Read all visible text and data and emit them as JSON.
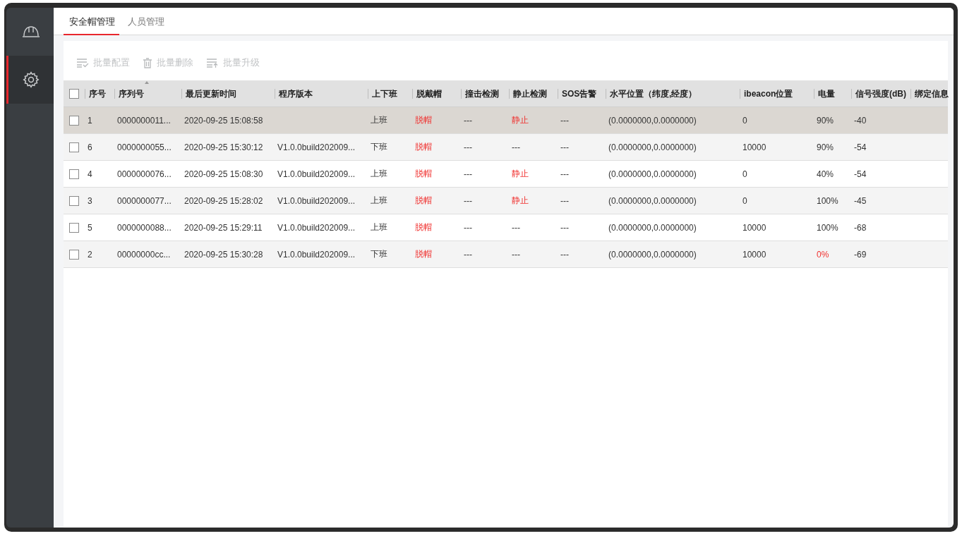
{
  "tabs": [
    {
      "label": "安全帽管理",
      "selected": true
    },
    {
      "label": "人员管理",
      "selected": false
    }
  ],
  "sidebar": {
    "items": [
      {
        "kind": "helmet",
        "selected": false
      },
      {
        "kind": "settings",
        "selected": true
      }
    ]
  },
  "toolbar": [
    {
      "kind": "config",
      "label": "批量配置",
      "disabled": true
    },
    {
      "kind": "delete",
      "label": "批量删除",
      "disabled": true
    },
    {
      "kind": "upgrade",
      "label": "批量升级",
      "disabled": true
    }
  ],
  "table": {
    "header_checked": false,
    "columns": [
      {
        "label": "序号",
        "sorted": false
      },
      {
        "label": "序列号",
        "sorted": true
      },
      {
        "label": "最后更新时间",
        "sorted": false
      },
      {
        "label": "程序版本",
        "sorted": false
      },
      {
        "label": "上下班",
        "sorted": false
      },
      {
        "label": "脱戴帽",
        "sorted": false
      },
      {
        "label": "撞击检测",
        "sorted": false
      },
      {
        "label": "静止检测",
        "sorted": false
      },
      {
        "label": "SOS告警",
        "sorted": false
      },
      {
        "label": "水平位置（纬度,经度）",
        "sorted": false
      },
      {
        "label": "ibeacon位置",
        "sorted": false
      },
      {
        "label": "电量",
        "sorted": false
      },
      {
        "label": "信号强度(dB)",
        "sorted": false
      },
      {
        "label": "绑定信息",
        "sorted": false
      }
    ],
    "rows": [
      {
        "selected": true,
        "checked": false,
        "cells": [
          {
            "text": "1"
          },
          {
            "text": "0000000011..."
          },
          {
            "text": "2020-09-25 15:08:58"
          },
          null,
          {
            "text": "上班"
          },
          {
            "text": "脱帽",
            "alert": true
          },
          {
            "text": "---"
          },
          {
            "text": "静止",
            "alert": true
          },
          {
            "text": "---"
          },
          {
            "text": "(0.0000000,0.0000000)"
          },
          {
            "text": "0"
          },
          {
            "text": "90%",
            "alert": false
          },
          {
            "text": "-40"
          }
        ]
      },
      {
        "selected": false,
        "checked": false,
        "cells": [
          {
            "text": "6"
          },
          {
            "text": "0000000055..."
          },
          {
            "text": "2020-09-25 15:30:12"
          },
          {
            "text": "V1.0.0build202009..."
          },
          {
            "text": "下班"
          },
          {
            "text": "脱帽",
            "alert": true
          },
          {
            "text": "---"
          },
          {
            "text": "---",
            "alert": false
          },
          {
            "text": "---"
          },
          {
            "text": "(0.0000000,0.0000000)"
          },
          {
            "text": "10000"
          },
          {
            "text": "90%",
            "alert": false
          },
          {
            "text": "-54"
          }
        ]
      },
      {
        "selected": false,
        "checked": false,
        "cells": [
          {
            "text": "4"
          },
          {
            "text": "0000000076..."
          },
          {
            "text": "2020-09-25 15:08:30"
          },
          {
            "text": "V1.0.0build202009..."
          },
          {
            "text": "上班"
          },
          {
            "text": "脱帽",
            "alert": true
          },
          {
            "text": "---"
          },
          {
            "text": "静止",
            "alert": true
          },
          {
            "text": "---"
          },
          {
            "text": "(0.0000000,0.0000000)"
          },
          {
            "text": "0"
          },
          {
            "text": "40%",
            "alert": false
          },
          {
            "text": "-54"
          }
        ]
      },
      {
        "selected": false,
        "checked": false,
        "cells": [
          {
            "text": "3"
          },
          {
            "text": "0000000077..."
          },
          {
            "text": "2020-09-25 15:28:02"
          },
          {
            "text": "V1.0.0build202009..."
          },
          {
            "text": "上班"
          },
          {
            "text": "脱帽",
            "alert": true
          },
          {
            "text": "---"
          },
          {
            "text": "静止",
            "alert": true
          },
          {
            "text": "---"
          },
          {
            "text": "(0.0000000,0.0000000)"
          },
          {
            "text": "0"
          },
          {
            "text": "100%",
            "alert": false
          },
          {
            "text": "-45"
          }
        ]
      },
      {
        "selected": false,
        "checked": false,
        "cells": [
          {
            "text": "5"
          },
          {
            "text": "0000000088..."
          },
          {
            "text": "2020-09-25 15:29:11"
          },
          {
            "text": "V1.0.0build202009..."
          },
          {
            "text": "上班"
          },
          {
            "text": "脱帽",
            "alert": true
          },
          {
            "text": "---"
          },
          {
            "text": "---",
            "alert": false
          },
          {
            "text": "---"
          },
          {
            "text": "(0.0000000,0.0000000)"
          },
          {
            "text": "10000"
          },
          {
            "text": "100%",
            "alert": false
          },
          {
            "text": "-68"
          }
        ]
      },
      {
        "selected": false,
        "checked": false,
        "cells": [
          {
            "text": "2"
          },
          {
            "text": "00000000cc..."
          },
          {
            "text": "2020-09-25 15:30:28"
          },
          {
            "text": "V1.0.0build202009..."
          },
          {
            "text": "下班"
          },
          {
            "text": "脱帽",
            "alert": true
          },
          {
            "text": "---"
          },
          {
            "text": "---",
            "alert": false
          },
          {
            "text": "---"
          },
          {
            "text": "(0.0000000,0.0000000)"
          },
          {
            "text": "10000"
          },
          {
            "text": "0%",
            "alert": true
          },
          {
            "text": "-69"
          }
        ]
      }
    ]
  }
}
